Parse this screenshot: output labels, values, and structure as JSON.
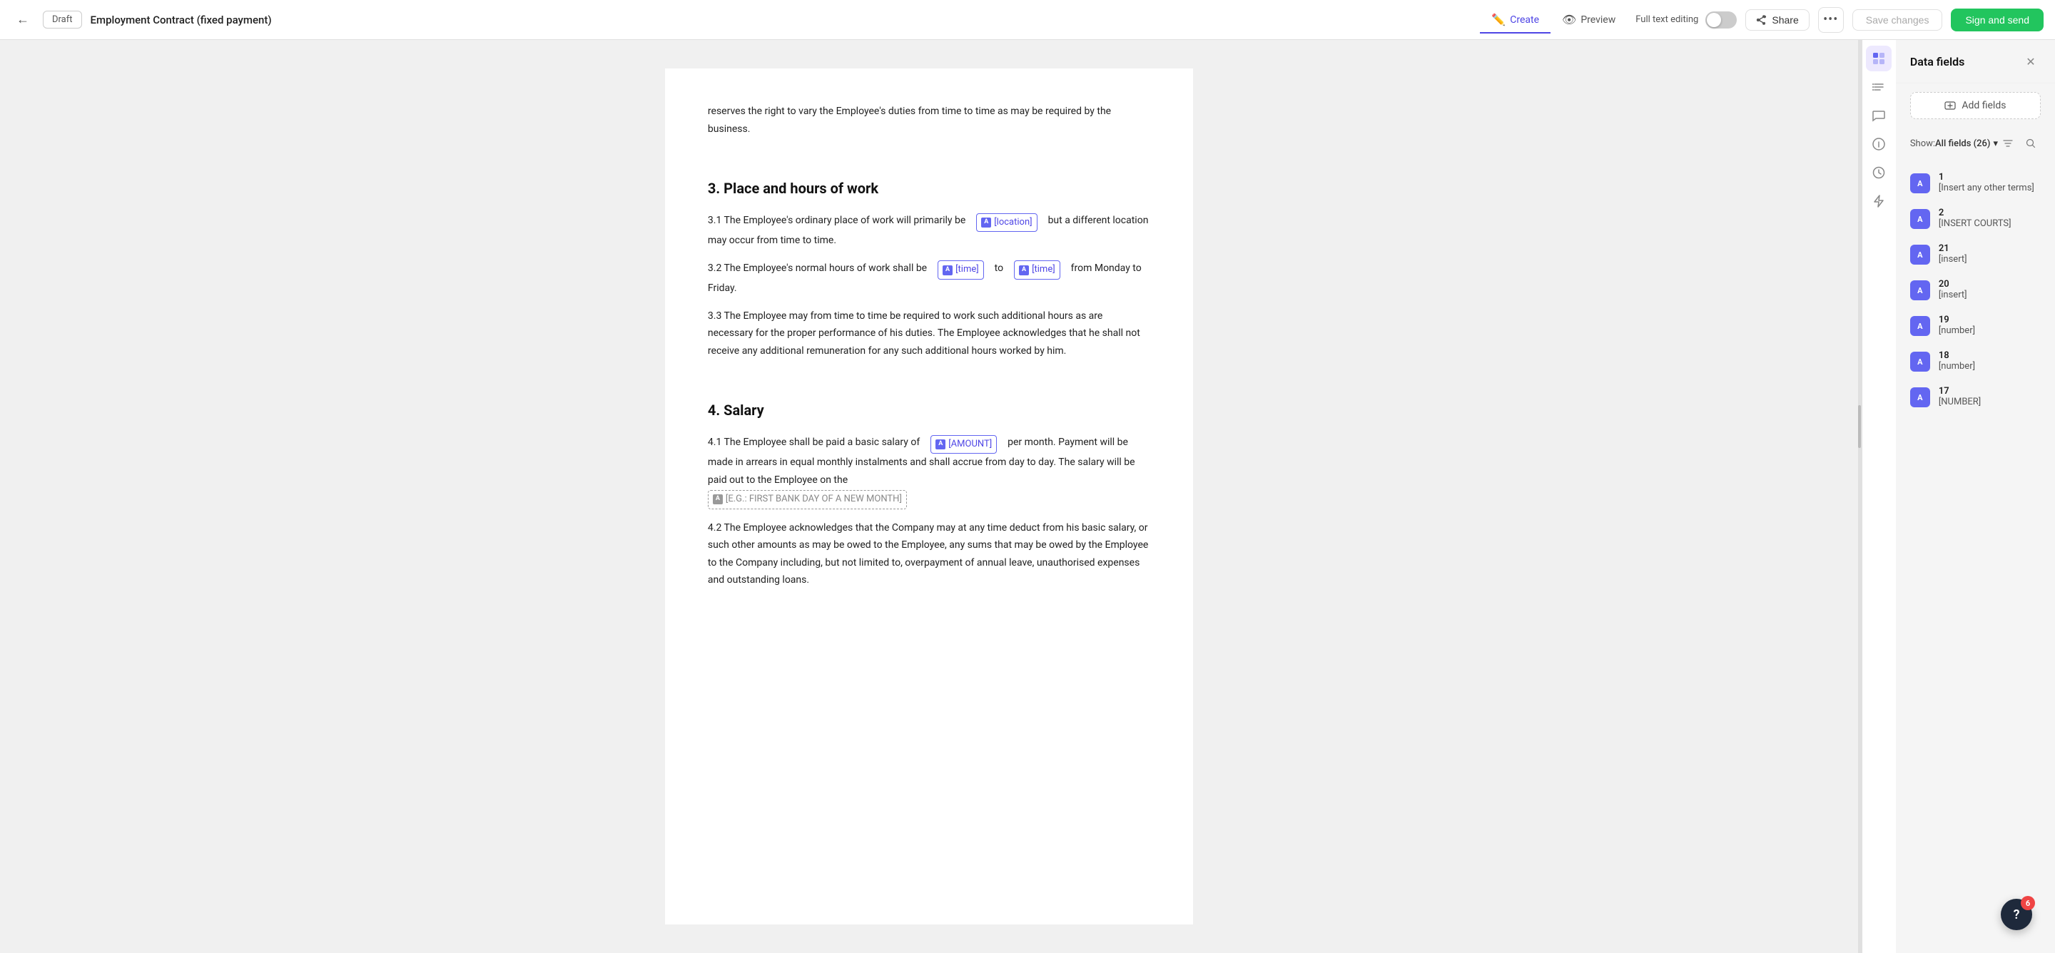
{
  "toolbar": {
    "back_label": "←",
    "draft_label": "Draft",
    "doc_title": "Employment Contract (fixed payment)",
    "tabs": [
      {
        "id": "create",
        "label": "Create",
        "icon": "✏️",
        "active": true
      },
      {
        "id": "preview",
        "label": "Preview",
        "icon": "👁",
        "active": false
      }
    ],
    "full_text_label": "Full text editing",
    "share_label": "Share",
    "more_label": "•••",
    "save_label": "Save changes",
    "sign_label": "Sign and send"
  },
  "document": {
    "intro_text": "reserves the right to vary the Employee's duties from time to time as may be required by the business.",
    "section3": {
      "heading": "3. Place and hours of work",
      "para1_before": "3.1 The Employee's ordinary place of work will primarily be",
      "para1_field": "[location]",
      "para1_after": "but a different location may occur from time to time.",
      "para2_before": "3.2  The Employee's normal hours of work shall be",
      "para2_field1": "[time]",
      "para2_mid": "to",
      "para2_field2": "[time]",
      "para2_after": "from Monday to Friday.",
      "para3": "3.3  The Employee may from time to time be required to work such additional hours as are necessary for the proper performance of his duties. The Employee acknowledges that he shall not receive any additional remuneration for any such additional hours worked by him."
    },
    "section4": {
      "heading": "4. Salary",
      "para1_before": "4.1 The Employee shall be paid a basic salary of",
      "para1_field": "[AMOUNT]",
      "para1_mid": "per month. Payment will be made in arrears in equal monthly instalments and shall accrue from day to day. The salary will be paid out to the Employee on the",
      "para1_field2": "[E.G.: FIRST BANK DAY OF A NEW MONTH]",
      "para2": "4.2 The Employee acknowledges that the Company may at any time deduct from his basic salary, or such other amounts as may be owed to the Employee, any sums that may be owed by the Employee to the Company including, but not limited to, overpayment of annual leave, unauthorised expenses and outstanding loans."
    }
  },
  "sidebar_icons": [
    {
      "id": "data-fields",
      "icon": "⊞",
      "active": true,
      "label": "data-fields-icon"
    },
    {
      "id": "checklist",
      "icon": "✓",
      "active": false,
      "label": "checklist-icon"
    },
    {
      "id": "comments",
      "icon": "💬",
      "active": false,
      "label": "comments-icon"
    },
    {
      "id": "info",
      "icon": "ℹ",
      "active": false,
      "label": "info-icon"
    },
    {
      "id": "history",
      "icon": "🕐",
      "active": false,
      "label": "history-icon"
    },
    {
      "id": "lightning",
      "icon": "⚡",
      "active": false,
      "label": "lightning-icon"
    }
  ],
  "data_fields_panel": {
    "title": "Data fields",
    "add_fields_label": "Add fields",
    "show_label": "Show:",
    "filter_value": "All fields (26)",
    "fields": [
      {
        "num": "1",
        "badge": "A",
        "name": "[Insert any other terms]"
      },
      {
        "num": "2",
        "badge": "A",
        "name": "[INSERT COURTS]"
      },
      {
        "num": "21",
        "badge": "A",
        "name": "[insert]"
      },
      {
        "num": "20",
        "badge": "A",
        "name": "[insert]"
      },
      {
        "num": "19",
        "badge": "A",
        "name": "[number]"
      },
      {
        "num": "18",
        "badge": "A",
        "name": "[number]"
      },
      {
        "num": "17",
        "badge": "A",
        "name": "[NUMBER]"
      }
    ]
  },
  "notification": {
    "count": "6",
    "icon": "?"
  }
}
